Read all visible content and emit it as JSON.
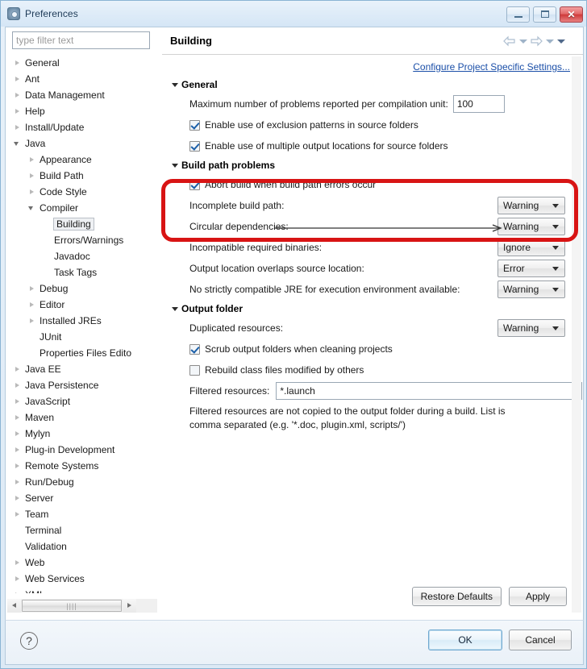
{
  "window": {
    "title": "Preferences",
    "icon": "preferences-gear-icon",
    "minimize_label": "Minimize",
    "maximize_label": "Maximize",
    "close_label": "Close"
  },
  "sidebar": {
    "filter": {
      "placeholder": "type filter text",
      "value": ""
    },
    "items": [
      {
        "label": "General",
        "indent": 0,
        "state": "collapsed"
      },
      {
        "label": "Ant",
        "indent": 0,
        "state": "collapsed"
      },
      {
        "label": "Data Management",
        "indent": 0,
        "state": "collapsed"
      },
      {
        "label": "Help",
        "indent": 0,
        "state": "collapsed"
      },
      {
        "label": "Install/Update",
        "indent": 0,
        "state": "collapsed"
      },
      {
        "label": "Java",
        "indent": 0,
        "state": "expanded"
      },
      {
        "label": "Appearance",
        "indent": 1,
        "state": "collapsed"
      },
      {
        "label": "Build Path",
        "indent": 1,
        "state": "collapsed"
      },
      {
        "label": "Code Style",
        "indent": 1,
        "state": "collapsed"
      },
      {
        "label": "Compiler",
        "indent": 1,
        "state": "expanded"
      },
      {
        "label": "Building",
        "indent": 2,
        "state": "leaf",
        "selected": true
      },
      {
        "label": "Errors/Warnings",
        "indent": 2,
        "state": "leaf"
      },
      {
        "label": "Javadoc",
        "indent": 2,
        "state": "leaf"
      },
      {
        "label": "Task Tags",
        "indent": 2,
        "state": "leaf"
      },
      {
        "label": "Debug",
        "indent": 1,
        "state": "collapsed"
      },
      {
        "label": "Editor",
        "indent": 1,
        "state": "collapsed"
      },
      {
        "label": "Installed JREs",
        "indent": 1,
        "state": "collapsed"
      },
      {
        "label": "JUnit",
        "indent": 1,
        "state": "leaf"
      },
      {
        "label": "Properties Files Edito",
        "indent": 1,
        "state": "leaf"
      },
      {
        "label": "Java EE",
        "indent": 0,
        "state": "collapsed"
      },
      {
        "label": "Java Persistence",
        "indent": 0,
        "state": "collapsed"
      },
      {
        "label": "JavaScript",
        "indent": 0,
        "state": "collapsed"
      },
      {
        "label": "Maven",
        "indent": 0,
        "state": "collapsed"
      },
      {
        "label": "Mylyn",
        "indent": 0,
        "state": "collapsed"
      },
      {
        "label": "Plug-in Development",
        "indent": 0,
        "state": "collapsed"
      },
      {
        "label": "Remote Systems",
        "indent": 0,
        "state": "collapsed"
      },
      {
        "label": "Run/Debug",
        "indent": 0,
        "state": "collapsed"
      },
      {
        "label": "Server",
        "indent": 0,
        "state": "collapsed"
      },
      {
        "label": "Team",
        "indent": 0,
        "state": "collapsed"
      },
      {
        "label": "Terminal",
        "indent": 0,
        "state": "leaf"
      },
      {
        "label": "Validation",
        "indent": 0,
        "state": "leaf"
      },
      {
        "label": "Web",
        "indent": 0,
        "state": "collapsed"
      },
      {
        "label": "Web Services",
        "indent": 0,
        "state": "collapsed"
      },
      {
        "label": "XML",
        "indent": 0,
        "state": "collapsed"
      }
    ]
  },
  "page": {
    "title": "Building",
    "project_link": "Configure Project Specific Settings...",
    "sections": [
      {
        "id": "general",
        "title": "General",
        "rows": [
          {
            "kind": "number",
            "label": "Maximum number of problems reported per compilation unit:",
            "value": "100"
          },
          {
            "kind": "checkbox",
            "label": "Enable use of exclusion patterns in source folders",
            "checked": true
          },
          {
            "kind": "checkbox",
            "label": "Enable use of multiple output locations for source folders",
            "checked": true
          }
        ]
      },
      {
        "id": "build-path-problems",
        "title": "Build path problems",
        "rows": [
          {
            "kind": "checkbox",
            "label": "Abort build when build path errors occur",
            "checked": true
          },
          {
            "kind": "combo",
            "label": "Incomplete build path:",
            "value": "Warning"
          },
          {
            "kind": "combo",
            "label": "Circular dependencies:",
            "value": "Warning"
          },
          {
            "kind": "combo",
            "label": "Incompatible required binaries:",
            "value": "Ignore"
          },
          {
            "kind": "combo",
            "label": "Output location overlaps source location:",
            "value": "Error"
          },
          {
            "kind": "combo",
            "label": "No strictly compatible JRE for execution environment available:",
            "value": "Warning"
          }
        ]
      },
      {
        "id": "output-folder",
        "title": "Output folder",
        "rows": [
          {
            "kind": "combo",
            "label": "Duplicated resources:",
            "value": "Warning"
          },
          {
            "kind": "checkbox",
            "label": "Scrub output folders when cleaning projects",
            "checked": true
          },
          {
            "kind": "checkbox",
            "label": "Rebuild class files modified by others",
            "checked": false
          },
          {
            "kind": "text",
            "label": "Filtered resources:",
            "value": "*.launch"
          }
        ],
        "help": "Filtered resources are not copied to the output folder during a build. List is comma separated (e.g. '*.doc, plugin.xml, scripts/')"
      }
    ],
    "buttons": {
      "restore_defaults": "Restore Defaults",
      "apply": "Apply"
    }
  },
  "footer": {
    "help_icon": "question-mark-icon",
    "ok": "OK",
    "cancel": "Cancel"
  },
  "annotations": {
    "highlight_color": "#d81414",
    "arrow_color": "#333333",
    "highlight_target": "Incomplete build path / Circular dependencies",
    "arrow_target": "Circular dependencies combo"
  },
  "nav": {
    "back": "back-arrow",
    "back_menu": "back-history-caret",
    "forward": "forward-arrow",
    "forward_menu": "forward-history-caret",
    "view_menu": "view-menu-caret"
  },
  "colors": {
    "accent": "#1b4fa8",
    "annotation_red": "#d81414",
    "title_bar": "#dfecf8"
  }
}
